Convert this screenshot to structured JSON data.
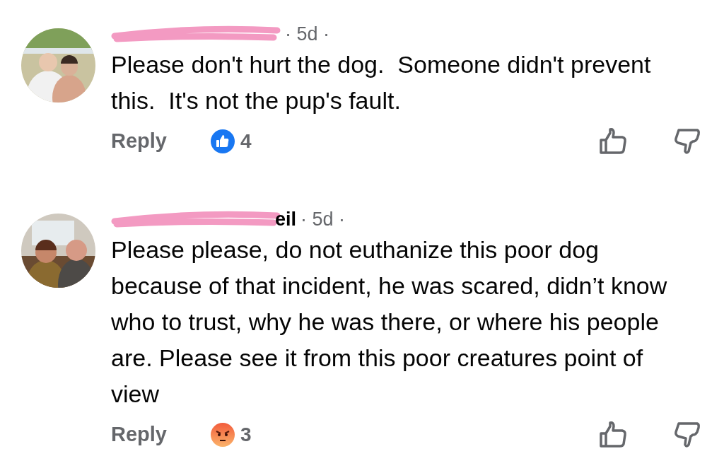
{
  "comments": [
    {
      "redacted": true,
      "age": "· 5d ·",
      "text": "Please don't hurt the dog.  Someone didn't prevent this.  It's not the pup's fault.",
      "reply": "Reply",
      "reaction": {
        "kind": "like",
        "count": "4"
      }
    },
    {
      "author_visible": "eil",
      "redacted": true,
      "age": "· 5d ·",
      "text": "Please please, do not euthanize this poor dog because of that incident, he was scared, didn’t know who to trust, why he was there, or where his people are. Please see it from this poor creatures point of view",
      "reply": "Reply",
      "reaction": {
        "kind": "angry",
        "count": "3"
      }
    }
  ]
}
